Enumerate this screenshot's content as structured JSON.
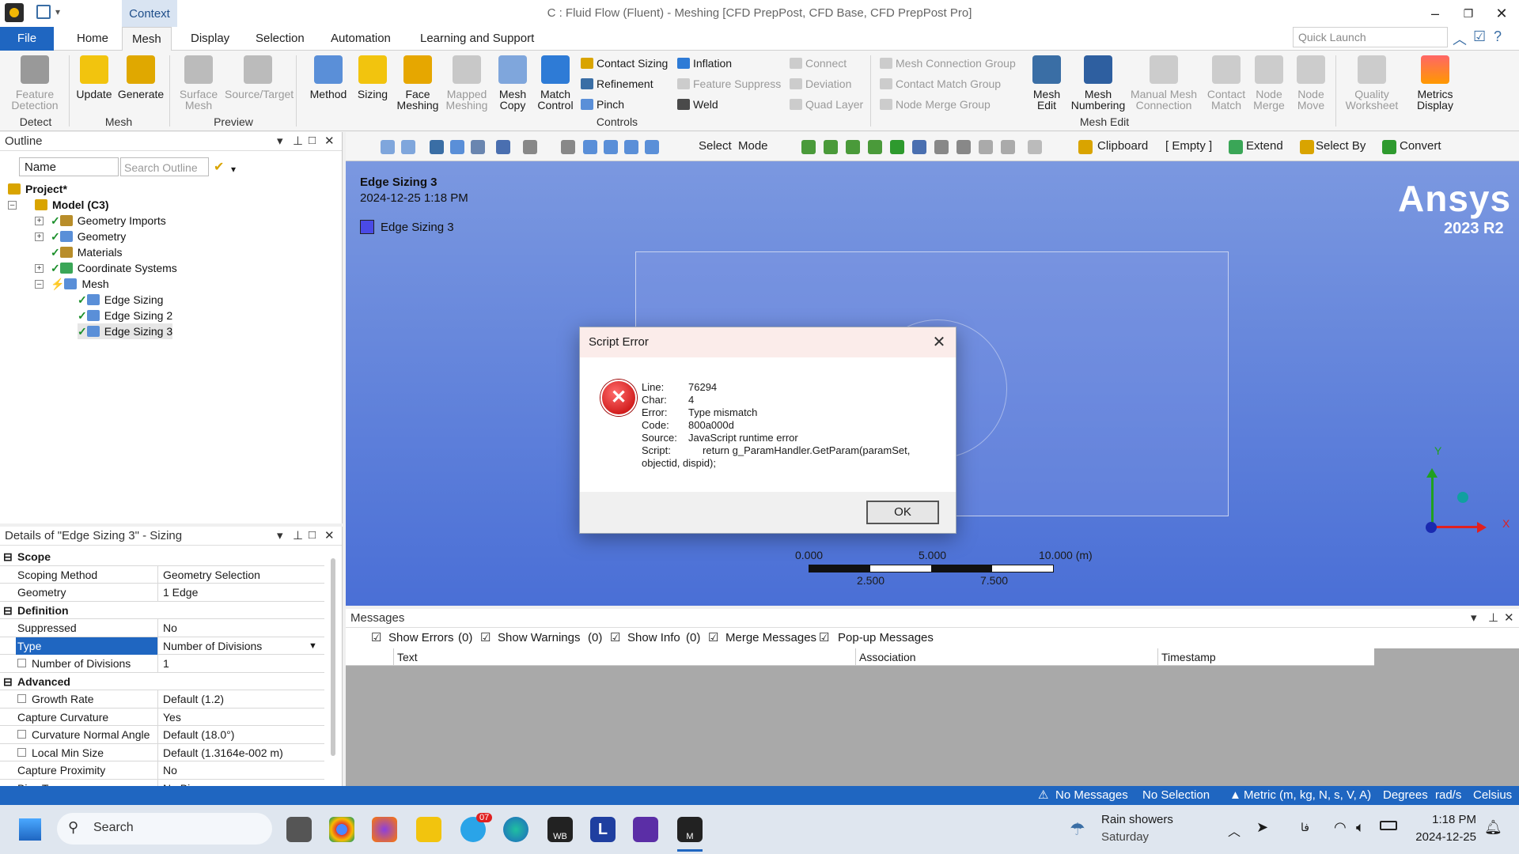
{
  "window": {
    "title": "C : Fluid Flow (Fluent) - Meshing [CFD PrepPost, CFD Base, CFD PrepPost Pro]",
    "context_tab": "Context"
  },
  "ribbon_tabs": [
    "File",
    "Home",
    "Mesh",
    "Display",
    "Selection",
    "Automation",
    "Learning and Support"
  ],
  "quick_launch": {
    "placeholder": "Quick Launch"
  },
  "ribbon": {
    "detect": {
      "btn": "Feature Detection",
      "group": "Detect"
    },
    "mesh": {
      "update": "Update",
      "generate": "Generate",
      "group": "Mesh"
    },
    "preview": {
      "surface": "Surface Mesh",
      "source": "Source/Target",
      "group": "Preview"
    },
    "controls": {
      "method": "Method",
      "sizing": "Sizing",
      "face_meshing": "Face Meshing",
      "mapped_meshing": "Mapped Meshing",
      "mesh_copy": "Mesh Copy",
      "match_control": "Match Control",
      "contact_sizing": "Contact Sizing",
      "refinement": "Refinement",
      "pinch": "Pinch",
      "inflation": "Inflation",
      "feature_suppress": "Feature Suppress",
      "weld": "Weld",
      "connect": "Connect",
      "deviation": "Deviation",
      "quad_layer": "Quad Layer",
      "group": "Controls"
    },
    "groups": {
      "connection_group": "Mesh Connection Group",
      "contact_match_group": "Contact Match Group",
      "node_merge_group": "Node Merge Group"
    },
    "mesh_edit": {
      "mesh_edit": "Mesh Edit",
      "numbering": "Mesh Numbering",
      "manual": "Manual Mesh Connection",
      "contact_match": "Contact Match",
      "node_merge": "Node Merge",
      "node_move": "Node Move",
      "group": "Mesh Edit"
    },
    "quality": {
      "worksheet": "Quality Worksheet",
      "metrics": "Metrics Display"
    }
  },
  "outline": {
    "title": "Outline",
    "name_filter": "Name",
    "search_placeholder": "Search Outline",
    "tree": [
      {
        "label": "Project*"
      },
      {
        "label": "Model (C3)"
      },
      {
        "label": "Geometry Imports"
      },
      {
        "label": "Geometry"
      },
      {
        "label": "Materials"
      },
      {
        "label": "Coordinate Systems"
      },
      {
        "label": "Mesh"
      },
      {
        "label": "Edge Sizing"
      },
      {
        "label": "Edge Sizing 2"
      },
      {
        "label": "Edge Sizing 3"
      }
    ]
  },
  "details": {
    "title": "Details of \"Edge Sizing 3\" - Sizing",
    "rows": [
      {
        "k": "Scope",
        "v": ""
      },
      {
        "k": "Scoping Method",
        "v": "Geometry Selection"
      },
      {
        "k": "Geometry",
        "v": "1 Edge"
      },
      {
        "k": "Definition",
        "v": ""
      },
      {
        "k": "Suppressed",
        "v": "No"
      },
      {
        "k": "Type",
        "v": "Number of Divisions"
      },
      {
        "k": "Number of Divisions",
        "v": "1"
      },
      {
        "k": "Advanced",
        "v": ""
      },
      {
        "k": "Growth Rate",
        "v": "Default (1.2)"
      },
      {
        "k": "Capture Curvature",
        "v": "Yes"
      },
      {
        "k": "Curvature Normal Angle",
        "v": "Default (18.0°)"
      },
      {
        "k": "Local Min Size",
        "v": "Default (1.3164e-002 m)"
      },
      {
        "k": "Capture Proximity",
        "v": "No"
      },
      {
        "k": "Bias Type",
        "v": "No Bias"
      }
    ]
  },
  "viewport_toolbar": {
    "select": "Select",
    "mode": "Mode",
    "clipboard": "Clipboard",
    "empty": "[ Empty ]",
    "extend": "Extend",
    "select_by": "Select By",
    "convert": "Convert"
  },
  "viewport": {
    "object_name": "Edge Sizing 3",
    "timestamp": "2024-12-25 1:18 PM",
    "legend_label": "Edge Sizing 3",
    "brand": "Ansys",
    "version": "2023 R2",
    "scale": {
      "t0": "0.000",
      "t2": "5.000",
      "t4": "10.000 (m)",
      "t1": "2.500",
      "t3": "7.500"
    },
    "axis_y": "Y",
    "axis_x": "X"
  },
  "messages": {
    "title": "Messages",
    "show_errors": "Show Errors",
    "errors_count": "(0)",
    "show_warnings": "Show Warnings",
    "warnings_count": "(0)",
    "show_info": "Show Info",
    "info_count": "(0)",
    "merge": "Merge Messages",
    "popup": "Pop-up Messages",
    "columns": [
      "Text",
      "Association",
      "Timestamp"
    ]
  },
  "statusbar": {
    "messages": "No Messages",
    "selection": "No Selection",
    "units": "Metric (m, kg, N, s, V, A)",
    "angle": "Degrees",
    "rate": "rad/s",
    "temp": "Celsius"
  },
  "dialog": {
    "title": "Script Error",
    "fields": [
      {
        "k": "Line:",
        "v": "76294"
      },
      {
        "k": "Char:",
        "v": "4"
      },
      {
        "k": "Error:",
        "v": "Type mismatch"
      },
      {
        "k": "Code:",
        "v": "800a000d"
      },
      {
        "k": "Source:",
        "v": "JavaScript runtime error"
      },
      {
        "k": "Script:",
        "v": "     return g_ParamHandler.GetParam(paramSet,"
      }
    ],
    "script_cont": "objectid, dispid);",
    "ok": "OK"
  },
  "taskbar": {
    "search": "Search",
    "weather": "Rain showers",
    "day": "Saturday",
    "time": "1:18 PM",
    "date": "2024-12-25",
    "badge": "07",
    "app_wb": "WB",
    "app_l": "L",
    "app_m": "M"
  },
  "colors": {
    "accent": "#1f66c1",
    "viewport_top": "#7b98e0",
    "viewport_bottom": "#4a6fd6",
    "error": "#c00000"
  }
}
